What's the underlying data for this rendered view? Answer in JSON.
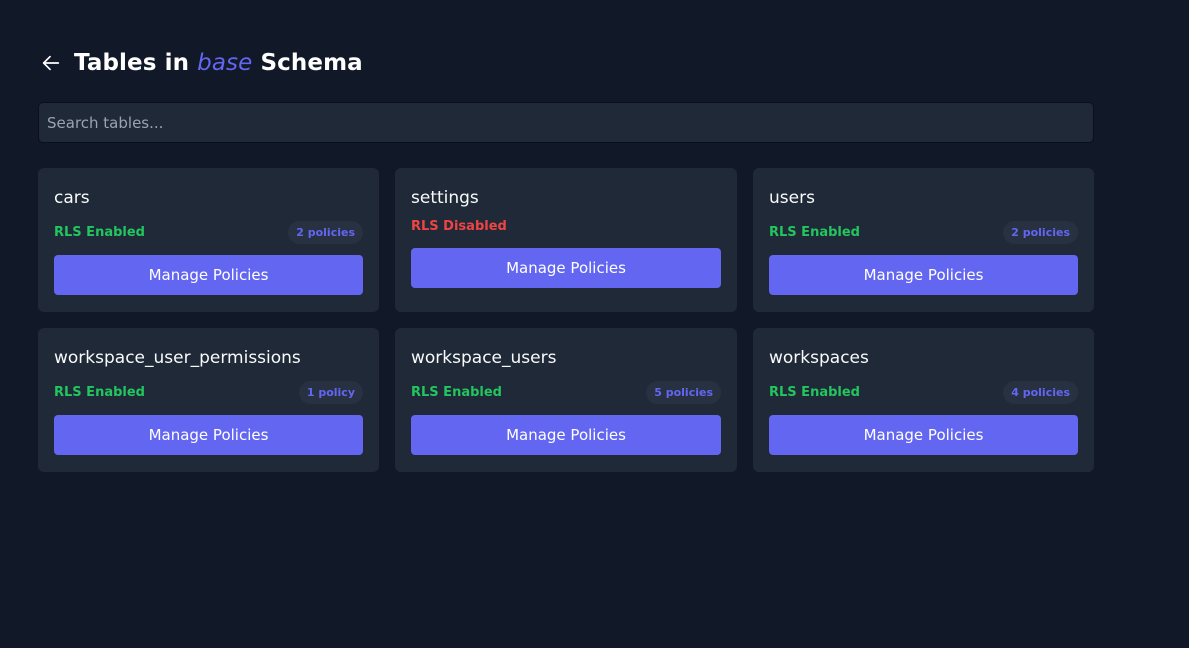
{
  "header": {
    "title_prefix": "Tables in ",
    "schema_name": "base",
    "title_suffix": " Schema",
    "back_icon": "arrow-left-icon"
  },
  "search": {
    "placeholder": "Search tables...",
    "value": ""
  },
  "colors": {
    "background": "#111827",
    "card": "#1f2937",
    "accent": "#6366f1",
    "enabled": "#22c55e",
    "disabled": "#ef4444"
  },
  "tables": [
    {
      "name": "cars",
      "rls": "RLS Enabled",
      "rls_enabled": true,
      "policies": "2 policies",
      "action": "Manage Policies"
    },
    {
      "name": "settings",
      "rls": "RLS Disabled",
      "rls_enabled": false,
      "policies": "",
      "action": "Manage Policies"
    },
    {
      "name": "users",
      "rls": "RLS Enabled",
      "rls_enabled": true,
      "policies": "2 policies",
      "action": "Manage Policies"
    },
    {
      "name": "workspace_user_permissions",
      "rls": "RLS Enabled",
      "rls_enabled": true,
      "policies": "1 policy",
      "action": "Manage Policies"
    },
    {
      "name": "workspace_users",
      "rls": "RLS Enabled",
      "rls_enabled": true,
      "policies": "5 policies",
      "action": "Manage Policies"
    },
    {
      "name": "workspaces",
      "rls": "RLS Enabled",
      "rls_enabled": true,
      "policies": "4 policies",
      "action": "Manage Policies"
    }
  ]
}
